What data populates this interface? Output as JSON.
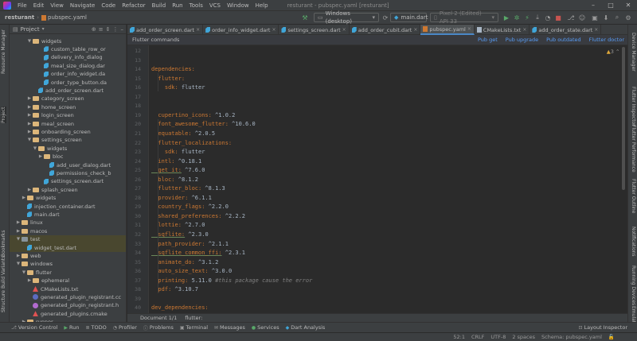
{
  "menubar": {
    "items": [
      "File",
      "Edit",
      "View",
      "Navigate",
      "Code",
      "Refactor",
      "Build",
      "Run",
      "Tools",
      "VCS",
      "Window",
      "Help"
    ],
    "window_title": "resturant - pubspec.yaml [resturant]"
  },
  "navbar": {
    "project": "resturant",
    "file": "pubspec.yaml",
    "device": "Windows (desktop)",
    "run_config": "main.dart",
    "emulator": "Pixel 2 (Edited) API 33"
  },
  "left_tools": [
    "Resource Manager",
    "Project",
    "Bookmarks",
    "Build Variants",
    "Structure"
  ],
  "right_tools": [
    "Device Manager",
    "Flutter Inspector",
    "Flutter Performance",
    "Flutter Outline",
    "Notifications",
    "Running Devices",
    "Emulator"
  ],
  "project_panel": {
    "title": "Project",
    "tree": [
      {
        "label": "widgets",
        "type": "folder",
        "level": 3,
        "open": true
      },
      {
        "label": "custom_table_row_or",
        "type": "dart",
        "level": 5
      },
      {
        "label": "delivery_info_dialog",
        "type": "dart",
        "level": 5
      },
      {
        "label": "meal_size_dialog.dar",
        "type": "dart",
        "level": 5
      },
      {
        "label": "order_info_widget.da",
        "type": "dart",
        "level": 5
      },
      {
        "label": "order_type_button.da",
        "type": "dart",
        "level": 5
      },
      {
        "label": "add_order_screen.dart",
        "type": "dart",
        "level": 4
      },
      {
        "label": "category_screen",
        "type": "folder",
        "level": 3,
        "open": false
      },
      {
        "label": "home_screen",
        "type": "folder",
        "level": 3,
        "open": false
      },
      {
        "label": "login_screen",
        "type": "folder",
        "level": 3,
        "open": false
      },
      {
        "label": "meal_screen",
        "type": "folder",
        "level": 3,
        "open": false
      },
      {
        "label": "onboarding_screen",
        "type": "folder",
        "level": 3,
        "open": false
      },
      {
        "label": "settings_screen",
        "type": "folder",
        "level": 3,
        "open": true
      },
      {
        "label": "widgets",
        "type": "folder",
        "level": 4,
        "open": true
      },
      {
        "label": "bloc",
        "type": "folder",
        "level": 5,
        "open": false
      },
      {
        "label": "add_user_dialog.dart",
        "type": "dart",
        "level": 6
      },
      {
        "label": "permissions_check_b",
        "type": "dart",
        "level": 6
      },
      {
        "label": "settings_screen.dart",
        "type": "dart",
        "level": 5
      },
      {
        "label": "splash_screen",
        "type": "folder",
        "level": 3,
        "open": false
      },
      {
        "label": "widgets",
        "type": "folder",
        "level": 2,
        "open": false
      },
      {
        "label": "injection_container.dart",
        "type": "dart",
        "level": 2
      },
      {
        "label": "main.dart",
        "type": "dart",
        "level": 2
      },
      {
        "label": "linux",
        "type": "folder",
        "level": 1,
        "open": false
      },
      {
        "label": "macos",
        "type": "folder",
        "level": 1,
        "open": false
      },
      {
        "label": "test",
        "type": "folder",
        "level": 1,
        "open": true,
        "highlight": true
      },
      {
        "label": "widget_test.dart",
        "type": "dart",
        "level": 2,
        "highlight": true
      },
      {
        "label": "web",
        "type": "folder",
        "level": 1,
        "open": false
      },
      {
        "label": "windows",
        "type": "folder",
        "level": 1,
        "open": true
      },
      {
        "label": "flutter",
        "type": "folder",
        "level": 2,
        "open": true
      },
      {
        "label": "ephemeral",
        "type": "folder",
        "level": 3,
        "open": false
      },
      {
        "label": "CMakeLists.txt",
        "type": "cmake",
        "level": 3
      },
      {
        "label": "generated_plugin_registrant.cc",
        "type": "cpp",
        "level": 3
      },
      {
        "label": "generated_plugin_registrant.h",
        "type": "h",
        "level": 3
      },
      {
        "label": "generated_plugins.cmake",
        "type": "cmake",
        "level": 3
      },
      {
        "label": "runner",
        "type": "folder",
        "level": 2,
        "open": false
      }
    ]
  },
  "tabs": [
    {
      "label": "add_order_screen.dart",
      "icon": "dart"
    },
    {
      "label": "order_info_widget.dart",
      "icon": "dart"
    },
    {
      "label": "settings_screen.dart",
      "icon": "dart"
    },
    {
      "label": "add_order_cubit.dart",
      "icon": "dart"
    },
    {
      "label": "pubspec.yaml",
      "icon": "yaml",
      "active": true
    },
    {
      "label": "CMakeLists.txt",
      "icon": "txt"
    },
    {
      "label": "add_order_state.dart",
      "icon": "dart"
    }
  ],
  "cmdbar": {
    "title": "Flutter commands",
    "links": [
      "Pub get",
      "Pub upgrade",
      "Pub outdated",
      "Flutter doctor"
    ]
  },
  "inspection": {
    "warnings": "3"
  },
  "editor": {
    "lines": [
      {
        "n": "12",
        "t": ""
      },
      {
        "n": "13",
        "t": ""
      },
      {
        "n": "14",
        "t": "dependencies:",
        "cls": "k"
      },
      {
        "n": "15",
        "t": "  flutter:",
        "cls": "k"
      },
      {
        "n": "16",
        "t": "    sdk: flutter",
        "key": "    sdk:",
        "val": " flutter"
      },
      {
        "n": "17",
        "t": ""
      },
      {
        "n": "18",
        "t": ""
      },
      {
        "n": "19",
        "t": "  cupertino_icons: ^1.0.2",
        "key": "  cupertino_icons:",
        "val": " ^1.0.2"
      },
      {
        "n": "20",
        "t": "  font_awesome_flutter: ^10.6.0",
        "key": "  font_awesome_flutter:",
        "val": " ^10.6.0"
      },
      {
        "n": "21",
        "t": "  equatable: ^2.0.5",
        "key": "  equatable:",
        "val": " ^2.0.5"
      },
      {
        "n": "22",
        "t": "  flutter_localizations:",
        "cls": "k"
      },
      {
        "n": "23",
        "t": "    sdk: flutter",
        "key": "    sdk:",
        "val": " flutter"
      },
      {
        "n": "24",
        "t": "  intl: ^0.18.1",
        "key": "  intl:",
        "val": " ^0.18.1"
      },
      {
        "n": "25",
        "t": "  get_it: ^7.6.0",
        "key": "  get_it:",
        "val": " ^7.6.0",
        "under": true
      },
      {
        "n": "26",
        "t": "  bloc: ^8.1.2",
        "key": "  bloc:",
        "val": " ^8.1.2"
      },
      {
        "n": "27",
        "t": "  flutter_bloc: ^8.1.3",
        "key": "  flutter_bloc:",
        "val": " ^8.1.3"
      },
      {
        "n": "28",
        "t": "  provider: ^6.1.1",
        "key": "  provider:",
        "val": " ^6.1.1"
      },
      {
        "n": "29",
        "t": "  country_flags: ^2.2.0",
        "key": "  country_flags:",
        "val": " ^2.2.0"
      },
      {
        "n": "30",
        "t": "  shared_preferences: ^2.2.2",
        "key": "  shared_preferences:",
        "val": " ^2.2.2"
      },
      {
        "n": "31",
        "t": "  lottie: ^2.7.0",
        "key": "  lottie:",
        "val": " ^2.7.0"
      },
      {
        "n": "32",
        "t": "  sqflite: ^2.3.0",
        "key": "  sqflite:",
        "val": " ^2.3.0",
        "under": true
      },
      {
        "n": "33",
        "t": "  path_provider: ^2.1.1",
        "key": "  path_provider:",
        "val": " ^2.1.1"
      },
      {
        "n": "34",
        "t": "  sqflite_common_ffi: ^2.3.1",
        "key": "  sqflite_common_ffi:",
        "val": " ^2.3.1",
        "under": true
      },
      {
        "n": "35",
        "t": "  animate_do: ^3.1.2",
        "key": "  animate_do:",
        "val": " ^3.1.2"
      },
      {
        "n": "36",
        "t": "  auto_size_text: ^3.0.0",
        "key": "  auto_size_text:",
        "val": " ^3.0.0"
      },
      {
        "n": "37",
        "t": "  printing: 5.11.0 #this package cause the error",
        "key": "  printing:",
        "val": " 5.11.0 ",
        "comment": "#this package cause the error"
      },
      {
        "n": "38",
        "t": "  pdf: ^3.10.7",
        "key": "  pdf:",
        "val": " ^3.10.7"
      },
      {
        "n": "39",
        "t": ""
      },
      {
        "n": "40",
        "t": "dev_dependencies:",
        "cls": "k"
      },
      {
        "n": "41",
        "t": "  flutter_test:",
        "cls": "k"
      }
    ]
  },
  "breadcrumb": {
    "document": "Document 1/1",
    "path": "flutter:"
  },
  "bottom_tools": [
    "Version Control",
    "Run",
    "TODO",
    "Profiler",
    "Problems",
    "Terminal",
    "Messages",
    "Services",
    "Dart Analysis"
  ],
  "layout_inspector": "Layout Inspector",
  "status": {
    "position": "52:1",
    "line_sep": "CRLF",
    "encoding": "UTF-8",
    "indent": "2 spaces",
    "schema": "Schema: pubspec.yaml"
  },
  "colors": {
    "accent": "#4a88c7",
    "keyword": "#cc7832",
    "link": "#589df6"
  }
}
